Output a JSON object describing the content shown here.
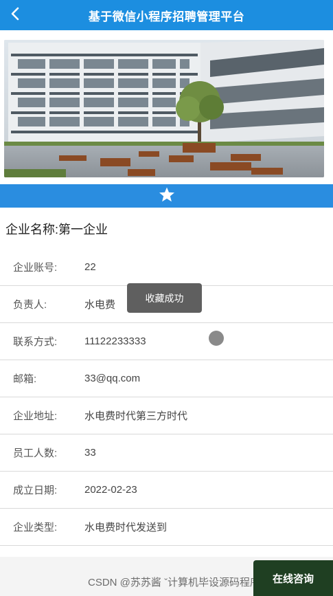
{
  "header": {
    "title": "基于微信小程序招聘管理平台",
    "back_icon": "chevron-left-icon"
  },
  "banner": {
    "image_subject": "campus building courtyard photo"
  },
  "favorite": {
    "icon": "star-icon"
  },
  "company": {
    "label": "企业名称:",
    "value": "第一企业"
  },
  "details": [
    {
      "label": "企业账号:",
      "value": "22"
    },
    {
      "label": "负责人:",
      "value": "水电费"
    },
    {
      "label": "联系方式:",
      "value": "11122233333"
    },
    {
      "label": "邮箱:",
      "value": "33@qq.com"
    },
    {
      "label": "企业地址:",
      "value": "水电费时代第三方时代"
    },
    {
      "label": "员工人数:",
      "value": "33"
    },
    {
      "label": "成立日期:",
      "value": "2022-02-23"
    },
    {
      "label": "企业类型:",
      "value": "水电费时代发送到"
    }
  ],
  "toast": {
    "text": "收藏成功"
  },
  "footer": {
    "watermark": "CSDN @苏苏酱   ˇ计算机毕设源码程序",
    "consult_label": "在线咨询"
  },
  "colors": {
    "header_bg": "#1c8ee0",
    "fav_bar_bg": "#2a8de0",
    "consult_bg": "#1f3f22"
  }
}
